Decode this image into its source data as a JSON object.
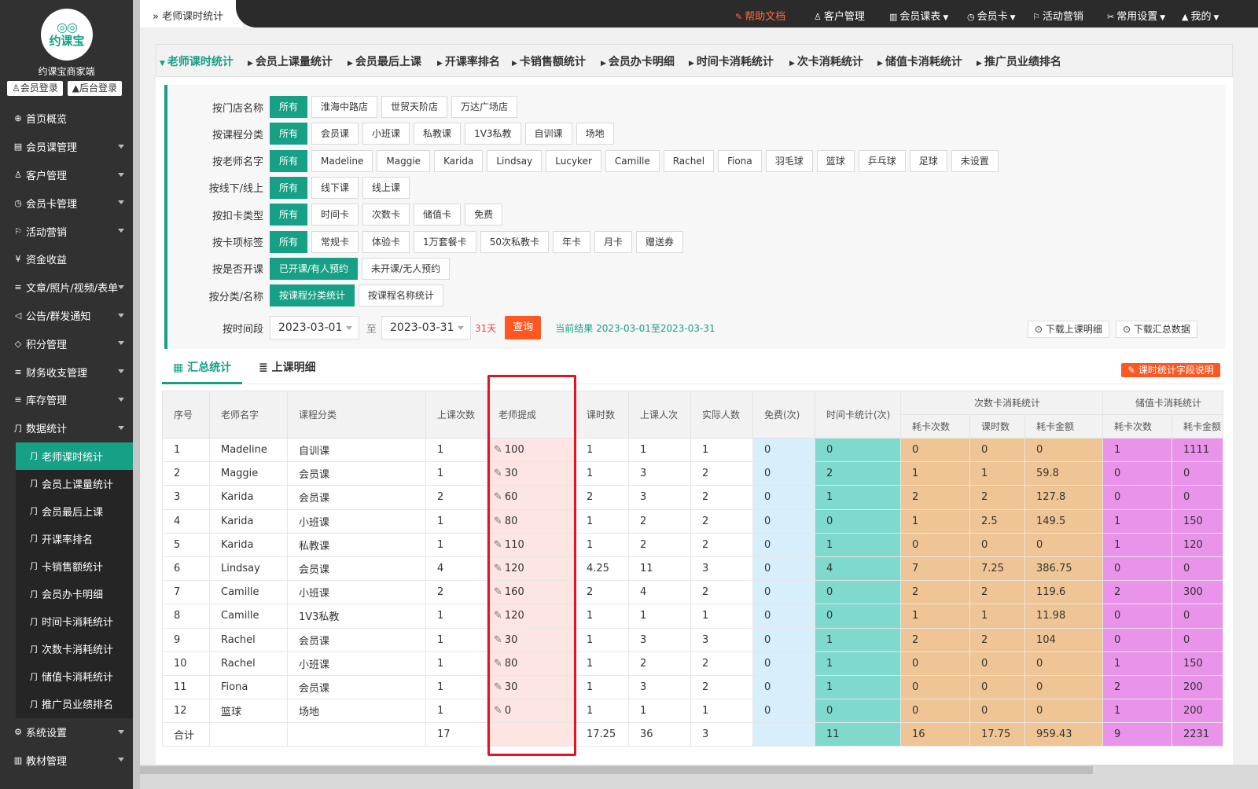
{
  "brand": {
    "logo_text": "约课宝",
    "shop_name": "约课宝商家端",
    "member_login": "会员登录",
    "admin_login": "后台登录"
  },
  "sidebar": {
    "items": [
      {
        "label": "首页概览",
        "icon": "globe-icon",
        "glyph": "⊕",
        "caret": false
      },
      {
        "label": "会员课管理",
        "icon": "document-icon",
        "glyph": "▤",
        "caret": true
      },
      {
        "label": "客户管理",
        "icon": "user-icon",
        "glyph": "♙",
        "caret": true
      },
      {
        "label": "会员卡管理",
        "icon": "clock-icon",
        "glyph": "◷",
        "caret": true
      },
      {
        "label": "活动营销",
        "icon": "flag-icon",
        "glyph": "⚐",
        "caret": true
      },
      {
        "label": "资金收益",
        "icon": "money-icon",
        "glyph": "¥",
        "caret": false
      },
      {
        "label": "文章/照片/视频/表单",
        "icon": "sliders-icon",
        "glyph": "≡",
        "caret": true
      },
      {
        "label": "公告/群发通知",
        "icon": "speaker-icon",
        "glyph": "◁",
        "caret": true
      },
      {
        "label": "积分管理",
        "icon": "diamond-icon",
        "glyph": "◇",
        "caret": true
      },
      {
        "label": "财务收支管理",
        "icon": "sliders-icon",
        "glyph": "≡",
        "caret": true
      },
      {
        "label": "库存管理",
        "icon": "sliders-icon",
        "glyph": "≡",
        "caret": true
      },
      {
        "label": "数据统计",
        "icon": "chart-icon",
        "glyph": "⺆",
        "caret": true
      }
    ],
    "sub_items": [
      {
        "label": "老师课时统计",
        "active": true
      },
      {
        "label": "会员上课量统计",
        "active": false
      },
      {
        "label": "会员最后上课",
        "active": false
      },
      {
        "label": "开课率排名",
        "active": false
      },
      {
        "label": "卡销售额统计",
        "active": false
      },
      {
        "label": "会员办卡明细",
        "active": false
      },
      {
        "label": "时间卡消耗统计",
        "active": false
      },
      {
        "label": "次数卡消耗统计",
        "active": false
      },
      {
        "label": "储值卡消耗统计",
        "active": false
      },
      {
        "label": "推广员业绩排名",
        "active": false
      }
    ],
    "bottom_items": [
      {
        "label": "系统设置",
        "icon": "settings-icon",
        "glyph": "⚙"
      },
      {
        "label": "教材管理",
        "icon": "book-icon",
        "glyph": "▥"
      }
    ]
  },
  "topbar": {
    "breadcrumb": "老师课时统计",
    "nav": [
      {
        "label": "帮助文档",
        "icon": "help-doc-icon",
        "glyph": "✎",
        "dropdown": false,
        "highlight": true
      },
      {
        "label": "客户管理",
        "icon": "user-icon",
        "glyph": "♙",
        "dropdown": false,
        "highlight": false
      },
      {
        "label": "会员课表",
        "icon": "book-icon",
        "glyph": "▥",
        "dropdown": true,
        "highlight": false
      },
      {
        "label": "会员卡",
        "icon": "clock-icon",
        "glyph": "◷",
        "dropdown": true,
        "highlight": false
      },
      {
        "label": "活动营销",
        "icon": "flag-icon",
        "glyph": "⚐",
        "dropdown": false,
        "highlight": false
      },
      {
        "label": "常用设置",
        "icon": "settings-icon",
        "glyph": "✂",
        "dropdown": true,
        "highlight": false
      },
      {
        "label": "我的",
        "icon": "person-icon",
        "glyph": "▲",
        "dropdown": true,
        "highlight": false
      }
    ]
  },
  "report_tabs": [
    "老师课时统计",
    "会员上课量统计",
    "会员最后上课",
    "开课率排名",
    "卡销售额统计",
    "会员办卡明细",
    "时间卡消耗统计",
    "次卡消耗统计",
    "储值卡消耗统计",
    "推广员业绩排名"
  ],
  "filters": [
    {
      "label": "按门店名称",
      "options": [
        "所有",
        "淮海中路店",
        "世贸天阶店",
        "万达广场店"
      ],
      "selected": 0
    },
    {
      "label": "按课程分类",
      "options": [
        "所有",
        "会员课",
        "小班课",
        "私教课",
        "1V3私教",
        "自训课",
        "场地"
      ],
      "selected": 0
    },
    {
      "label": "按老师名字",
      "options": [
        "所有",
        "Madeline",
        "Maggie",
        "Karida",
        "Lindsay",
        "Lucyker",
        "Camille",
        "Rachel",
        "Fiona",
        "羽毛球",
        "篮球",
        "乒乓球",
        "足球",
        "未设置"
      ],
      "selected": 0
    },
    {
      "label": "按线下/线上",
      "options": [
        "所有",
        "线下课",
        "线上课"
      ],
      "selected": 0
    },
    {
      "label": "按扣卡类型",
      "options": [
        "所有",
        "时间卡",
        "次数卡",
        "储值卡",
        "免费"
      ],
      "selected": 0
    },
    {
      "label": "按卡项标签",
      "options": [
        "所有",
        "常规卡",
        "体验卡",
        "1万套餐卡",
        "50次私教卡",
        "年卡",
        "月卡",
        "赠送券"
      ],
      "selected": 0
    },
    {
      "label": "按是否开课",
      "options": [
        "已开课/有人预约",
        "未开课/无人预约"
      ],
      "selected": 0
    },
    {
      "label": "按分类/名称",
      "options": [
        "按课程分类统计",
        "按课程名称统计"
      ],
      "selected": 0
    }
  ],
  "date_filter": {
    "label": "按时间段",
    "start": "2023-03-01",
    "to": "至",
    "end": "2023-03-31",
    "days": "31天",
    "query": "查询",
    "current": "当前结果 2023-03-01至2023-03-31"
  },
  "downloads": {
    "detail": "下载上课明细",
    "summary": "下载汇总数据"
  },
  "sub_tabs": {
    "summary": "汇总统计",
    "detail": "上课明细",
    "explain": "课时统计字段说明"
  },
  "table": {
    "headers": [
      "序号",
      "老师名字",
      "课程分类",
      "上课次数",
      "老师提成",
      "课时数",
      "上课人次",
      "实际人数",
      "免费(次)",
      "时间卡统计(次)"
    ],
    "group_count": "次数卡消耗统计",
    "group_stored": "储值卡消耗统计",
    "count_sub": [
      "耗卡次数",
      "课时数",
      "耗卡金额"
    ],
    "stored_sub": [
      "耗卡次数",
      "耗卡金额"
    ],
    "rows": [
      [
        "1",
        "Madeline",
        "自训课",
        "1",
        "100",
        "1",
        "1",
        "1",
        "0",
        "0",
        "0",
        "0",
        "0",
        "1",
        "1111"
      ],
      [
        "2",
        "Maggie",
        "会员课",
        "1",
        "30",
        "1",
        "3",
        "2",
        "0",
        "2",
        "1",
        "1",
        "59.8",
        "0",
        "0"
      ],
      [
        "3",
        "Karida",
        "会员课",
        "2",
        "60",
        "2",
        "3",
        "2",
        "0",
        "1",
        "2",
        "2",
        "127.8",
        "0",
        "0"
      ],
      [
        "4",
        "Karida",
        "小班课",
        "1",
        "80",
        "1",
        "2",
        "2",
        "0",
        "0",
        "1",
        "2.5",
        "149.5",
        "1",
        "150"
      ],
      [
        "5",
        "Karida",
        "私教课",
        "1",
        "110",
        "1",
        "2",
        "2",
        "0",
        "1",
        "0",
        "0",
        "0",
        "1",
        "120"
      ],
      [
        "6",
        "Lindsay",
        "会员课",
        "4",
        "120",
        "4.25",
        "11",
        "3",
        "0",
        "4",
        "7",
        "7.25",
        "386.75",
        "0",
        "0"
      ],
      [
        "7",
        "Camille",
        "小班课",
        "2",
        "160",
        "2",
        "4",
        "2",
        "0",
        "0",
        "2",
        "2",
        "119.6",
        "2",
        "300"
      ],
      [
        "8",
        "Camille",
        "1V3私教",
        "1",
        "120",
        "1",
        "1",
        "1",
        "0",
        "0",
        "1",
        "1",
        "11.98",
        "0",
        "0"
      ],
      [
        "9",
        "Rachel",
        "会员课",
        "1",
        "30",
        "1",
        "3",
        "3",
        "0",
        "1",
        "2",
        "2",
        "104",
        "0",
        "0"
      ],
      [
        "10",
        "Rachel",
        "小班课",
        "1",
        "80",
        "1",
        "2",
        "2",
        "0",
        "1",
        "0",
        "0",
        "0",
        "1",
        "150"
      ],
      [
        "11",
        "Fiona",
        "会员课",
        "1",
        "30",
        "1",
        "3",
        "2",
        "0",
        "1",
        "0",
        "0",
        "0",
        "2",
        "200"
      ],
      [
        "12",
        "篮球",
        "场地",
        "1",
        "0",
        "1",
        "1",
        "1",
        "0",
        "0",
        "0",
        "0",
        "0",
        "1",
        "200"
      ]
    ],
    "total": [
      "合计",
      "",
      "",
      "17",
      "",
      "17.25",
      "36",
      "3",
      "",
      "11",
      "16",
      "17.75",
      "959.43",
      "9",
      "2231"
    ]
  },
  "colors": {
    "accent": "#16a085",
    "query": "#ff5722",
    "highlight_box": "#e81123",
    "pink": "#fde5e3",
    "blue": "#d7eefb",
    "teal": "#7fd9cc",
    "orange": "#f0c595",
    "magenta": "#e993ea"
  }
}
